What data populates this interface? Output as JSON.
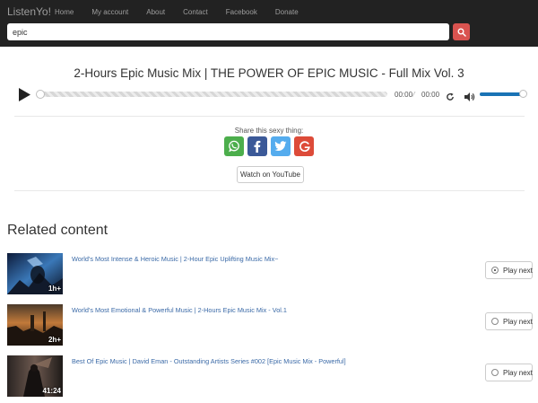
{
  "navbar": {
    "brand": "ListenYo!",
    "links": [
      "Home",
      "My account",
      "About",
      "Contact",
      "Facebook",
      "Donate"
    ]
  },
  "search": {
    "value": "epic"
  },
  "player": {
    "title": "2-Hours Epic Music Mix | THE POWER OF EPIC MUSIC - Full Mix Vol. 3",
    "current_time": "00:00",
    "time_separator": "⁄",
    "duration": "00:00",
    "progress": 0,
    "volume": 1.0
  },
  "share": {
    "label": "Share this sexy thing:",
    "buttons": [
      {
        "name": "whatsapp",
        "color": "#4cae4c"
      },
      {
        "name": "facebook",
        "color": "#3b5998"
      },
      {
        "name": "twitter",
        "color": "#55acee"
      },
      {
        "name": "google",
        "color": "#dd4b39"
      }
    ]
  },
  "youtube_button": "Watch on YouTube",
  "related": {
    "heading": "Related content",
    "items": [
      {
        "title": "World's Most Intense & Heroic Music | 2-Hour Epic Uplifting Music Mix~",
        "duration": "1h+",
        "play_next": "Play next",
        "selected": true
      },
      {
        "title": "World's Most Emotional & Powerful Music | 2-Hours Epic Music Mix - Vol.1",
        "duration": "2h+",
        "play_next": "Play next",
        "selected": false
      },
      {
        "title": "Best Of Epic Music | David Eman - Outstanding Artists Series #002 [Epic Music Mix - Powerful]",
        "duration": "41:24",
        "play_next": "Play next",
        "selected": false
      }
    ]
  },
  "colors": {
    "navbar_bg": "#222222",
    "search_button": "#d9534f",
    "link": "#3b6aa7",
    "volume": "#1a73b5"
  }
}
